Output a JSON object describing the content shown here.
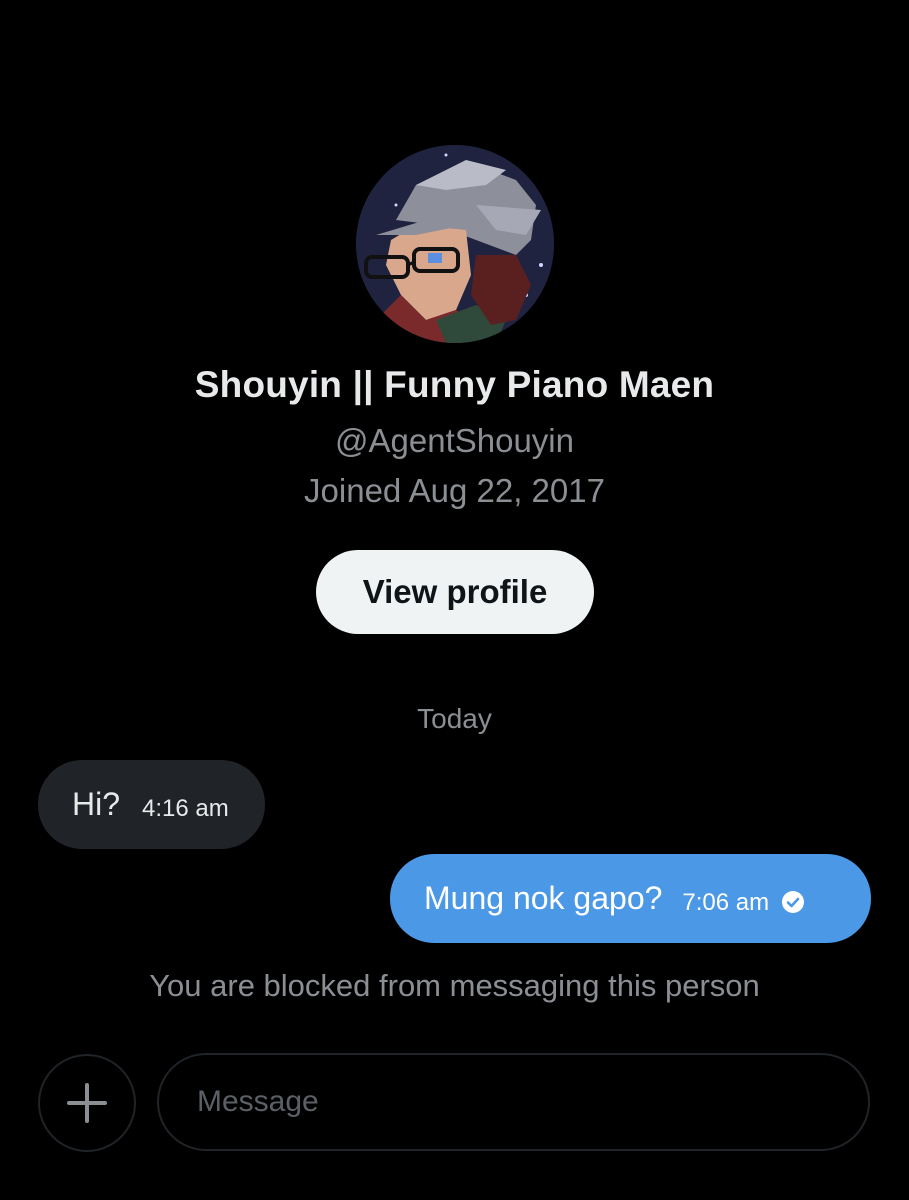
{
  "profile": {
    "display_name": "Shouyin || Funny Piano Maen",
    "handle": "@AgentShouyin",
    "joined": "Joined Aug 22, 2017",
    "view_profile_label": "View profile"
  },
  "conversation": {
    "date_divider": "Today",
    "messages": [
      {
        "direction": "incoming",
        "text": "Hi?",
        "time": "4:16 am"
      },
      {
        "direction": "outgoing",
        "text": "Mung nok gapo?",
        "time": "7:06 am",
        "status_icon": "check-circle-icon"
      }
    ],
    "blocked_notice": "You are blocked from messaging this person"
  },
  "composer": {
    "add_icon": "plus-icon",
    "placeholder": "Message"
  },
  "colors": {
    "background": "#000000",
    "incoming_bubble": "#202327",
    "outgoing_bubble": "#4b98e6",
    "primary_text": "#e7e9ea",
    "secondary_text": "#8b8f94",
    "button_bg": "#eff3f4"
  }
}
